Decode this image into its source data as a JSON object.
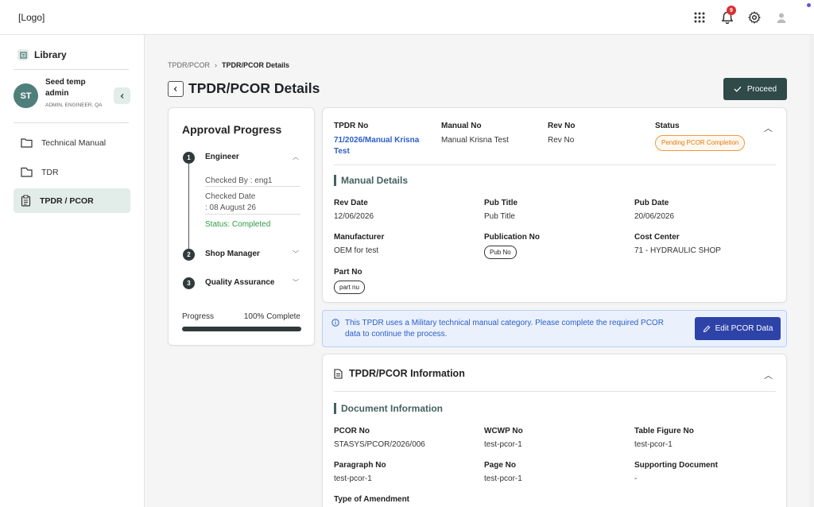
{
  "app": {
    "logo": "[Logo]",
    "notification_count": "9",
    "icons": {
      "apps": "apps-grid-icon",
      "bell": "bell-icon",
      "settings": "gear-icon",
      "user": "user-icon"
    }
  },
  "sidebar": {
    "title": "Library",
    "user": {
      "initials": "ST",
      "name": "Seed temp admin",
      "roles": "ADMIN, ENGINEER, QA"
    },
    "items": [
      {
        "label": "Technical Manual",
        "icon": "folder-icon"
      },
      {
        "label": "TDR",
        "icon": "folder-tab-icon"
      },
      {
        "label": "TPDR / PCOR",
        "icon": "clipboard-icon",
        "active": true
      }
    ]
  },
  "breadcrumb": {
    "parent": "TPDR/PCOR",
    "current": "TPDR/PCOR Details"
  },
  "page": {
    "title": "TPDR/PCOR Details",
    "proceed_label": "Proceed"
  },
  "approval": {
    "title": "Approval Progress",
    "steps": [
      {
        "num": "1",
        "label": "Engineer",
        "checked_by": "Checked By : eng1",
        "checked_date": "Checked Date",
        "date_value": ": 08 August 26",
        "status": "Status: Completed"
      },
      {
        "num": "2",
        "label": "Shop Manager"
      },
      {
        "num": "3",
        "label": "Quality Assurance"
      }
    ],
    "progress_label": "Progress",
    "progress_value": "100% Complete",
    "progress_fraction": 1.0
  },
  "summary": {
    "tpdr_no_label": "TPDR No",
    "tpdr_no": "71/2026/Manual Krisna Test",
    "manual_no_label": "Manual No",
    "manual_no": "Manual Krisna Test",
    "rev_no_label": "Rev No",
    "rev_no": "Rev No",
    "status_label": "Status",
    "status": "Pending PCOR Completion"
  },
  "manual_details": {
    "title": "Manual Details",
    "rev_date_label": "Rev Date",
    "rev_date": "12/06/2026",
    "pub_title_label": "Pub Title",
    "pub_title": "Pub Title",
    "pub_date_label": "Pub Date",
    "pub_date": "20/06/2026",
    "manufacturer_label": "Manufacturer",
    "manufacturer": "OEM for test",
    "publication_no_label": "Publication No",
    "publication_no": "Pub No",
    "cost_center_label": "Cost Center",
    "cost_center": "71 - HYDRAULIC SHOP",
    "part_no_label": "Part No",
    "part_no": "part nu"
  },
  "info": {
    "message": "This TPDR uses a Military technical manual category. Please complete the required PCOR data to continue the process.",
    "edit_label": "Edit PCOR Data"
  },
  "pcor_info": {
    "title": "TPDR/PCOR Information",
    "doc_title": "Document Information",
    "pcor_no_label": "PCOR No",
    "pcor_no": "STASYS/PCOR/2026/006",
    "wcwp_no_label": "WCWP No",
    "wcwp_no": "test-pcor-1",
    "table_fig_label": "Table Figure No",
    "table_fig": "test-pcor-1",
    "paragraph_label": "Paragraph No",
    "paragraph": "test-pcor-1",
    "page_no_label": "Page No",
    "page_no": "test-pcor-1",
    "supporting_label": "Supporting Document",
    "supporting": "-",
    "amendment_label": "Type of Amendment"
  }
}
